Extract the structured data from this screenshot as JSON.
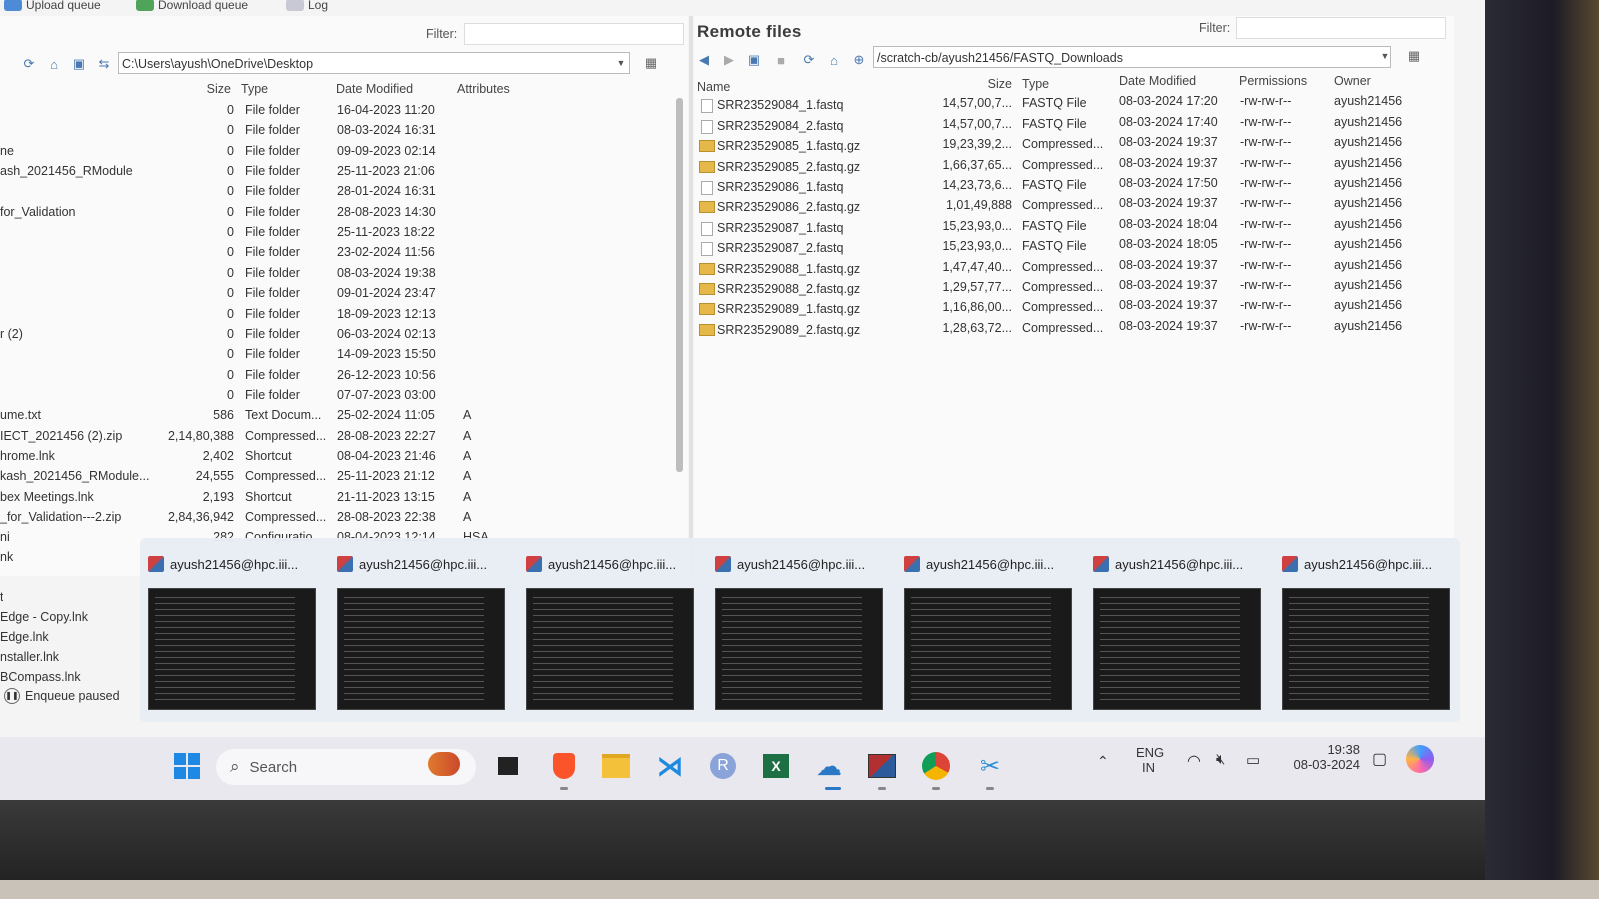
{
  "top_toolbar": {
    "upload_queue": "Upload queue",
    "download_queue": "Download queue",
    "log": "Log"
  },
  "local": {
    "filter_label": "Filter:",
    "path": "C:\\Users\\ayush\\OneDrive\\Desktop",
    "columns": [
      "Size",
      "Type",
      "Date Modified",
      "Attributes"
    ],
    "rows": [
      {
        "name": "",
        "size": "0",
        "type": "File folder",
        "date": "16-04-2023 11:20",
        "attr": ""
      },
      {
        "name": "",
        "size": "0",
        "type": "File folder",
        "date": "08-03-2024 16:31",
        "attr": ""
      },
      {
        "name": "ne",
        "size": "0",
        "type": "File folder",
        "date": "09-09-2023 02:14",
        "attr": ""
      },
      {
        "name": "ash_2021456_RModule",
        "size": "0",
        "type": "File folder",
        "date": "25-11-2023 21:06",
        "attr": ""
      },
      {
        "name": "",
        "size": "0",
        "type": "File folder",
        "date": "28-01-2024 16:31",
        "attr": ""
      },
      {
        "name": "for_Validation",
        "size": "0",
        "type": "File folder",
        "date": "28-08-2023 14:30",
        "attr": ""
      },
      {
        "name": "",
        "size": "0",
        "type": "File folder",
        "date": "25-11-2023 18:22",
        "attr": ""
      },
      {
        "name": "",
        "size": "0",
        "type": "File folder",
        "date": "23-02-2024 11:56",
        "attr": ""
      },
      {
        "name": "",
        "size": "0",
        "type": "File folder",
        "date": "08-03-2024 19:38",
        "attr": ""
      },
      {
        "name": "",
        "size": "0",
        "type": "File folder",
        "date": "09-01-2024 23:47",
        "attr": ""
      },
      {
        "name": "",
        "size": "0",
        "type": "File folder",
        "date": "18-09-2023 12:13",
        "attr": ""
      },
      {
        "name": "r (2)",
        "size": "0",
        "type": "File folder",
        "date": "06-03-2024 02:13",
        "attr": ""
      },
      {
        "name": "",
        "size": "0",
        "type": "File folder",
        "date": "14-09-2023 15:50",
        "attr": ""
      },
      {
        "name": "",
        "size": "0",
        "type": "File folder",
        "date": "26-12-2023 10:56",
        "attr": ""
      },
      {
        "name": "",
        "size": "0",
        "type": "File folder",
        "date": "07-07-2023 03:00",
        "attr": ""
      },
      {
        "name": "ume.txt",
        "size": "586",
        "type": "Text Docum...",
        "date": "25-02-2024 11:05",
        "attr": "A"
      },
      {
        "name": "IECT_2021456 (2).zip",
        "size": "2,14,80,388",
        "type": "Compressed...",
        "date": "28-08-2023 22:27",
        "attr": "A"
      },
      {
        "name": "hrome.lnk",
        "size": "2,402",
        "type": "Shortcut",
        "date": "08-04-2023 21:46",
        "attr": "A"
      },
      {
        "name": "kash_2021456_RModule...",
        "size": "24,555",
        "type": "Compressed...",
        "date": "25-11-2023 21:12",
        "attr": "A"
      },
      {
        "name": "bex Meetings.lnk",
        "size": "2,193",
        "type": "Shortcut",
        "date": "21-11-2023 13:15",
        "attr": "A"
      },
      {
        "name": "_for_Validation---2.zip",
        "size": "2,84,36,942",
        "type": "Compressed...",
        "date": "28-08-2023 22:38",
        "attr": "A"
      },
      {
        "name": "ni",
        "size": "282",
        "type": "Configuratio...",
        "date": "08-04-2023 12:14",
        "attr": "HSA"
      }
    ],
    "extra_names": [
      "nk",
      "t",
      "Edge - Copy.lnk",
      "Edge.lnk",
      "nstaller.lnk",
      "BCompass.lnk"
    ]
  },
  "remote": {
    "title": "Remote files",
    "filter_label": "Filter:",
    "path": "/scratch-cb/ayush21456/FASTQ_Downloads",
    "columns": [
      "Name",
      "Size",
      "Type",
      "Date Modified",
      "Permissions",
      "Owner"
    ],
    "rows": [
      {
        "name": "SRR23529084_1.fastq",
        "size": "14,57,00,7...",
        "type": "FASTQ File",
        "date": "08-03-2024 17:20",
        "perm": "-rw-rw-r--",
        "owner": "ayush21456",
        "icon": "file"
      },
      {
        "name": "SRR23529084_2.fastq",
        "size": "14,57,00,7...",
        "type": "FASTQ File",
        "date": "08-03-2024 17:40",
        "perm": "-rw-rw-r--",
        "owner": "ayush21456",
        "icon": "file"
      },
      {
        "name": "SRR23529085_1.fastq.gz",
        "size": "19,23,39,2...",
        "type": "Compressed...",
        "date": "08-03-2024 19:37",
        "perm": "-rw-rw-r--",
        "owner": "ayush21456",
        "icon": "zip"
      },
      {
        "name": "SRR23529085_2.fastq.gz",
        "size": "1,66,37,65...",
        "type": "Compressed...",
        "date": "08-03-2024 19:37",
        "perm": "-rw-rw-r--",
        "owner": "ayush21456",
        "icon": "zip"
      },
      {
        "name": "SRR23529086_1.fastq",
        "size": "14,23,73,6...",
        "type": "FASTQ File",
        "date": "08-03-2024 17:50",
        "perm": "-rw-rw-r--",
        "owner": "ayush21456",
        "icon": "file"
      },
      {
        "name": "SRR23529086_2.fastq.gz",
        "size": "1,01,49,888",
        "type": "Compressed...",
        "date": "08-03-2024 19:37",
        "perm": "-rw-rw-r--",
        "owner": "ayush21456",
        "icon": "zip"
      },
      {
        "name": "SRR23529087_1.fastq",
        "size": "15,23,93,0...",
        "type": "FASTQ File",
        "date": "08-03-2024 18:04",
        "perm": "-rw-rw-r--",
        "owner": "ayush21456",
        "icon": "file"
      },
      {
        "name": "SRR23529087_2.fastq",
        "size": "15,23,93,0...",
        "type": "FASTQ File",
        "date": "08-03-2024 18:05",
        "perm": "-rw-rw-r--",
        "owner": "ayush21456",
        "icon": "file"
      },
      {
        "name": "SRR23529088_1.fastq.gz",
        "size": "1,47,47,40...",
        "type": "Compressed...",
        "date": "08-03-2024 19:37",
        "perm": "-rw-rw-r--",
        "owner": "ayush21456",
        "icon": "zip"
      },
      {
        "name": "SRR23529088_2.fastq.gz",
        "size": "1,29,57,77...",
        "type": "Compressed...",
        "date": "08-03-2024 19:37",
        "perm": "-rw-rw-r--",
        "owner": "ayush21456",
        "icon": "zip"
      },
      {
        "name": "SRR23529089_1.fastq.gz",
        "size": "1,16,86,00...",
        "type": "Compressed...",
        "date": "08-03-2024 19:37",
        "perm": "-rw-rw-r--",
        "owner": "ayush21456",
        "icon": "zip"
      },
      {
        "name": "SRR23529089_2.fastq.gz",
        "size": "1,28,63,72...",
        "type": "Compressed...",
        "date": "08-03-2024 19:37",
        "perm": "-rw-rw-r--",
        "owner": "ayush21456",
        "icon": "zip"
      }
    ]
  },
  "thumbnails": {
    "titles": [
      "ayush21456@hpc.iii...",
      "ayush21456@hpc.iii...",
      "ayush21456@hpc.iii...",
      "ayush21456@hpc.iii...",
      "ayush21456@hpc.iii...",
      "ayush21456@hpc.iii...",
      "ayush21456@hpc.iii..."
    ]
  },
  "status": {
    "text": "Enqueue paused"
  },
  "taskbar": {
    "search_placeholder": "Search",
    "lang_1": "ENG",
    "lang_2": "IN",
    "time": "19:38",
    "date": "08-03-2024",
    "apps": [
      "widgets-icon",
      "task-view-icon",
      "brave-icon",
      "file-explorer-icon",
      "vscode-icon",
      "r-icon",
      "excel-icon",
      "cloud-sync-icon",
      "terminal-icon",
      "chrome-icon",
      "snipping-tool-icon"
    ]
  },
  "colors": {
    "accent": "#3a6fb0",
    "taskbar": "#e8e8ee",
    "folder": "#e6b84a"
  }
}
